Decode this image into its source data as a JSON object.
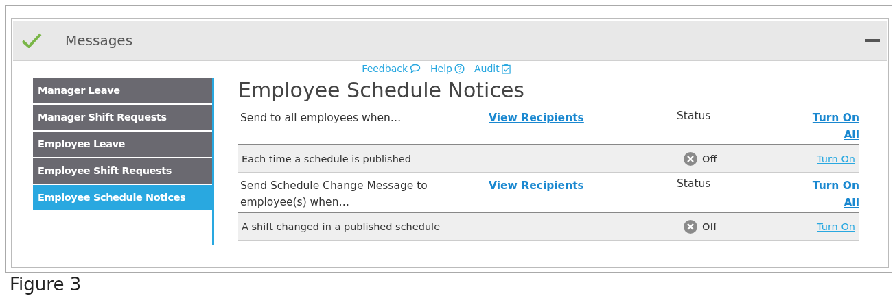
{
  "panel": {
    "title": "Messages",
    "complete": true,
    "expanded": true
  },
  "links": [
    {
      "label": "Feedback",
      "kind": "feedback"
    },
    {
      "label": "Help",
      "kind": "help"
    },
    {
      "label": "Audit",
      "kind": "audit"
    }
  ],
  "sidebar": {
    "items": [
      {
        "label": "Manager Leave",
        "selected": false
      },
      {
        "label": "Manager Shift Requests",
        "selected": false
      },
      {
        "label": "Employee Leave",
        "selected": false
      },
      {
        "label": "Employee Shift Requests",
        "selected": false
      },
      {
        "label": "Employee Schedule Notices",
        "selected": true
      }
    ]
  },
  "page_title": "Employee Schedule Notices",
  "sections": [
    {
      "heading": "Send to all employees when…",
      "recipients_link": "View Recipients",
      "status_heading": "Status",
      "turn_on_all": "Turn On All",
      "rows": [
        {
          "label": "Each time a schedule is published",
          "on": false,
          "status": "Off",
          "action": "Turn On"
        }
      ]
    },
    {
      "heading": "Send Schedule Change Message to employee(s) when…",
      "recipients_link": "View Recipients",
      "status_heading": "Status",
      "turn_on_all": "Turn On All",
      "rows": [
        {
          "label": "A shift changed in a published schedule",
          "on": false,
          "status": "Off",
          "action": "Turn On"
        }
      ]
    }
  ],
  "caption": "Figure 3"
}
